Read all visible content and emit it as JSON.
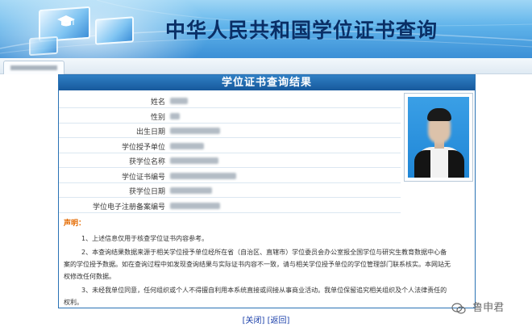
{
  "banner": {
    "title": "中华人民共和国学位证书查询"
  },
  "tab": {
    "label": ""
  },
  "panel": {
    "title": "学位证书查询结果",
    "rows": [
      {
        "label": "姓名",
        "value_blur_width": 22
      },
      {
        "label": "性别",
        "value_blur_width": 12
      },
      {
        "label": "出生日期",
        "value_blur_width": 62
      },
      {
        "label": "学位授予单位",
        "value_blur_width": 42
      },
      {
        "label": "获学位名称",
        "value_blur_width": 60
      },
      {
        "label": "学位证书编号",
        "value_blur_width": 82
      },
      {
        "label": "获学位日期",
        "value_blur_width": 52
      },
      {
        "label": "学位电子注册备案编号",
        "value_blur_width": 62
      }
    ]
  },
  "notice": {
    "title": "声明：",
    "items": [
      "1、上述信息仅用于核查学位证书内容参考。",
      "2、本查询结果数据来源于相关学位授予单位经所在省（自治区、直辖市）学位委员会办公室报全国学位与研究生教育数据中心备案的学位授予数据。如在查询过程中如发现查询结果与实际证书内容不一致，请与相关学位授予单位的学位管理部门联系核实。本网站无权修改任何数据。",
      "3、未经我单位同意，任何组织或个人不得擅自利用本系统直接或间接从事商业活动。我单位保留追究相关组织及个人法律责任的权利。"
    ]
  },
  "links": {
    "close": "[关闭]",
    "back": "[返回]"
  },
  "watermark": {
    "text": "鲁申君"
  },
  "colors": {
    "header_blue": "#17599c",
    "notice_orange": "#e46a00",
    "link_blue": "#1a3faa"
  }
}
